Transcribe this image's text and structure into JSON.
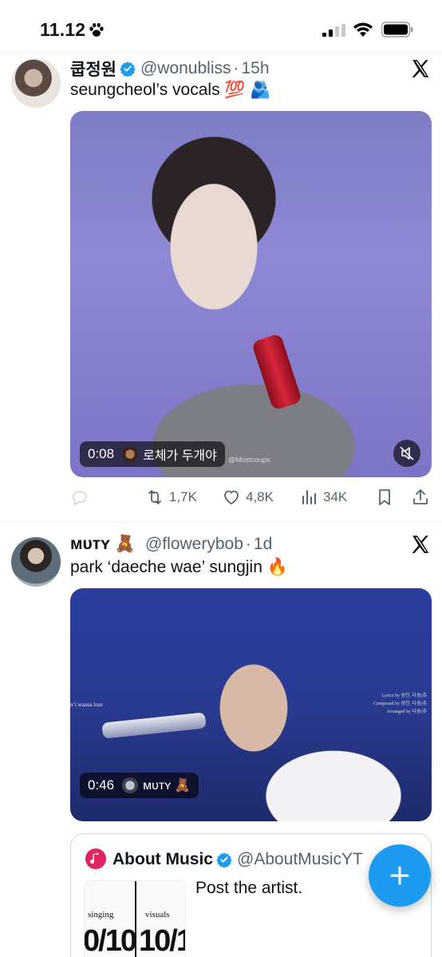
{
  "status_bar": {
    "time": "11.12",
    "extra_icon": "paw-icon",
    "signal_icon": "cellular-signal-icon",
    "wifi_icon": "wifi-icon",
    "battery_icon": "battery-icon"
  },
  "tweets": [
    {
      "display_name": "쿱정원",
      "handle": "@wonubliss",
      "separator": "·",
      "age": "15h",
      "text": "seungcheol’s vocals 💯 🫂",
      "media": {
        "duration": "0:08",
        "source_name": "로체가 두개야",
        "watermark": "@Mostcoups",
        "muted": true
      },
      "stats": {
        "replies": "",
        "retweets": "1,7K",
        "likes": "4,8K",
        "views": "34K"
      }
    },
    {
      "display_name": "ᴍᴜᴛʏ 🧸",
      "handle": "@flowerybob",
      "separator": "·",
      "age": "1d",
      "text": "park ‘daeche wae’ sungjin 🔥",
      "media": {
        "duration": "0:46",
        "source_name": "ᴍᴜᴛʏ 🧸",
        "lyric_fragment": "n’t wanna lose",
        "credits": [
          "Lyrics by 성진, 다솜(츄",
          "Composed by 성진, 다솜(츄",
          "Arranged by 다솜(츄"
        ]
      },
      "quote": {
        "display_name": "About Music",
        "handle": "@AboutMusicYT",
        "text": "Post the artist.",
        "thumb_labels": [
          "singing",
          "visuals"
        ],
        "thumb_scores": [
          "0/10",
          "10/1("
        ]
      }
    }
  ],
  "colors": {
    "accent": "#1d9bf0",
    "text": "#0f1419",
    "muted": "#536471",
    "border": "#cfd9de"
  }
}
